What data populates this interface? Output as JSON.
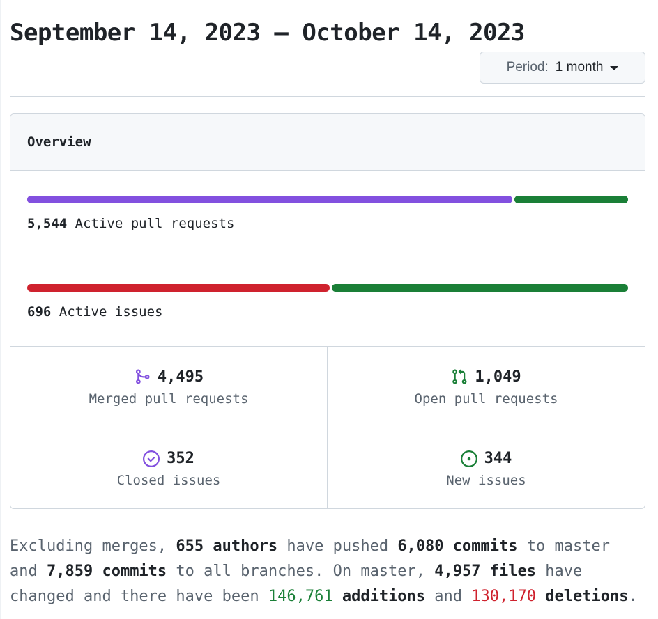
{
  "header": {
    "date_range": "September 14, 2023 – October 14, 2023",
    "period_label": "Period:",
    "period_value": "1 month"
  },
  "overview": {
    "title": "Overview",
    "pull_requests": {
      "count": "5,544",
      "label": "Active pull requests",
      "merged_fraction": 0.8108,
      "open_fraction": 0.1892,
      "merged_color": "#8250df",
      "open_color": "#1a7f37"
    },
    "issues": {
      "count": "696",
      "label": "Active issues",
      "closed_fraction": 0.5057,
      "new_fraction": 0.4943,
      "closed_color": "#cf222e",
      "new_color": "#1a7f37"
    },
    "stats": {
      "merged": {
        "value": "4,495",
        "label": "Merged pull requests",
        "icon": "git-merge-icon"
      },
      "open": {
        "value": "1,049",
        "label": "Open pull requests",
        "icon": "git-pull-request-icon"
      },
      "closed_issues": {
        "value": "352",
        "label": "Closed issues",
        "icon": "issue-closed-icon"
      },
      "new_issues": {
        "value": "344",
        "label": "New issues",
        "icon": "issue-opened-icon"
      }
    }
  },
  "summary": {
    "t1": "Excluding merges, ",
    "authors": "655 authors",
    "t2": " have pushed ",
    "commits_master": "6,080 commits",
    "t3": " to master and ",
    "commits_all": "7,859 commits",
    "t4": " to all branches. On master, ",
    "files": "4,957 files",
    "t5": " have changed and there have been ",
    "additions_num": "146,761",
    "additions_word": " additions",
    "t6": " and ",
    "deletions_num": "130,170",
    "deletions_word": " deletions",
    "t7": "."
  }
}
